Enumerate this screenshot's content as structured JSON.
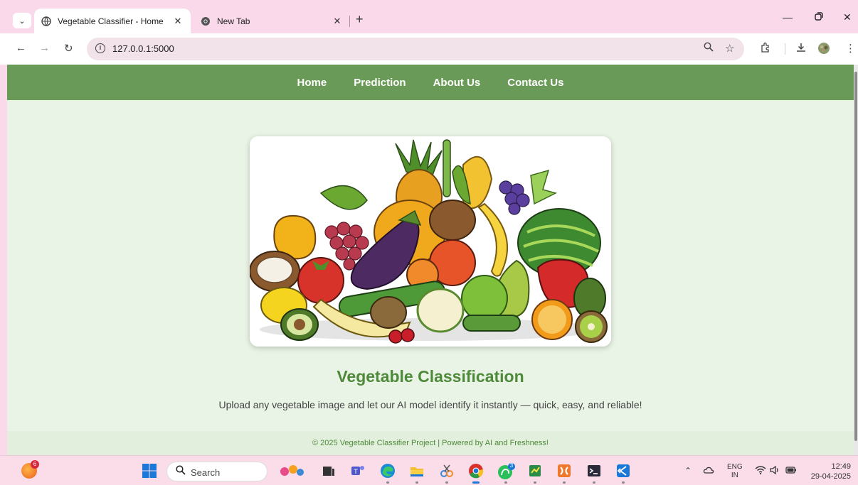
{
  "browser": {
    "tabs": [
      {
        "title": "Vegetable Classifier - Home",
        "active": true
      },
      {
        "title": "New Tab",
        "active": false
      }
    ],
    "address": "127.0.0.1:5000"
  },
  "site": {
    "nav": [
      "Home",
      "Prediction",
      "About Us",
      "Contact Us"
    ],
    "headline": "Vegetable Classification",
    "tagline": "Upload any vegetable image and let our AI model identify it instantly — quick, easy, and reliable!",
    "footer": "© 2025 Vegetable Classifier Project | Powered by AI and Freshness!"
  },
  "taskbar": {
    "search_placeholder": "Search",
    "notification_count": "6",
    "whatsapp_badge": "3",
    "language_line1": "ENG",
    "language_line2": "IN",
    "time": "12:49",
    "date": "29-04-2025"
  },
  "colors": {
    "nav_bar": "#6a9a58",
    "page_background": "#eaf4e6",
    "headline": "#4e8a3a",
    "browser_frame": "#f9d9ea"
  }
}
